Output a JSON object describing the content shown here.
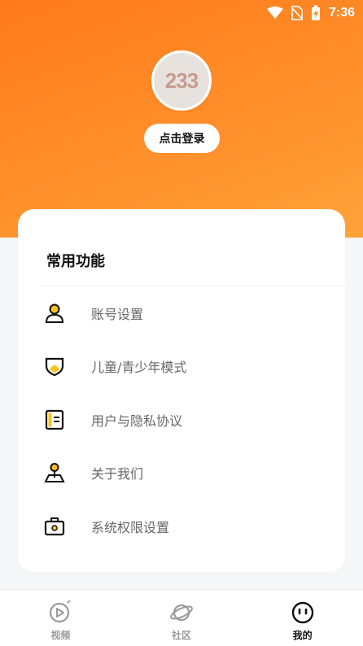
{
  "status_bar": {
    "time": "7:36"
  },
  "profile": {
    "avatar_text": "233",
    "login_label": "点击登录"
  },
  "card": {
    "title": "常用功能",
    "items": [
      {
        "label": "账号设置",
        "icon": "user-icon"
      },
      {
        "label": "儿童/青少年模式",
        "icon": "shield-icon"
      },
      {
        "label": "用户与隐私协议",
        "icon": "document-icon"
      },
      {
        "label": "关于我们",
        "icon": "location-pin-icon"
      },
      {
        "label": "系统权限设置",
        "icon": "toolbox-icon"
      }
    ]
  },
  "nav": {
    "items": [
      {
        "label": "视频",
        "icon": "video-play-icon",
        "active": false
      },
      {
        "label": "社区",
        "icon": "planet-icon",
        "active": false
      },
      {
        "label": "我的",
        "icon": "face-icon",
        "active": true
      }
    ]
  },
  "colors": {
    "accent": "#ff7a1a",
    "icon_yellow": "#ffc21a"
  }
}
